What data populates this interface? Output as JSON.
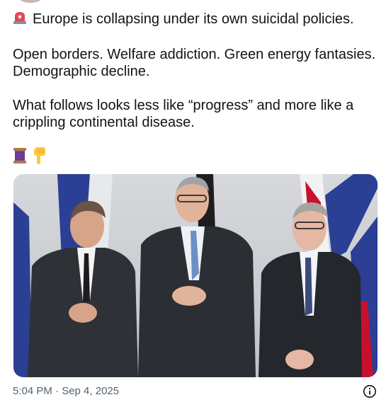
{
  "tweet": {
    "headline": "Europe is collapsing under its own suicidal policies.",
    "line2": "Open borders. Welfare addiction. Green energy fantasies. Demographic decline.",
    "line3": "What follows looks less like “progress” and more like a crippling continental disease.",
    "headline_emoji": "rotating-light-icon",
    "trailing_emojis": [
      "thread-spool-icon",
      "pointing-down-hand-icon"
    ]
  },
  "photo": {
    "subject_icon": "three-men-in-suits-photo"
  },
  "footer": {
    "timestamp": "5:04 PM · Sep 4, 2025",
    "info_icon": "info-circle-icon"
  },
  "colors": {
    "text": "#0f1419",
    "muted": "#536471",
    "background": "#ffffff"
  }
}
